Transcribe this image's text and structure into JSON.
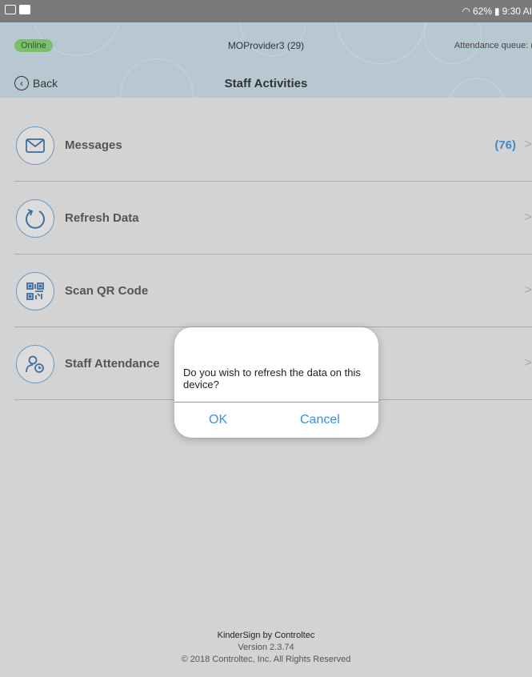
{
  "status_bar": {
    "battery": "62%",
    "time": "9:30 AI"
  },
  "header": {
    "status": "Online",
    "provider": "MOProvider3 (29)",
    "attendance_queue": "Attendance queue: (",
    "back_label": "Back",
    "title": "Staff Activities"
  },
  "items": [
    {
      "label": "Messages",
      "count": "(76)",
      "icon": "envelope-icon"
    },
    {
      "label": "Refresh Data",
      "count": "",
      "icon": "refresh-icon"
    },
    {
      "label": "Scan QR Code",
      "count": "",
      "icon": "qr-code-icon"
    },
    {
      "label": "Staff Attendance",
      "count": "",
      "icon": "staff-clock-icon"
    }
  ],
  "chevron": ">",
  "dialog": {
    "message": "Do you wish to refresh the data on this device?",
    "ok": "OK",
    "cancel": "Cancel"
  },
  "footer": {
    "brand": "KinderSign by Controltec",
    "version": "Version 2.3.74",
    "copyright": "© 2018 Controltec, Inc. All Rights Reserved"
  },
  "colors": {
    "accent": "#4a88c5",
    "dialog_button": "#3a8ee8",
    "online": "#7bbf6a",
    "header_bg": "#b8c8d3"
  }
}
